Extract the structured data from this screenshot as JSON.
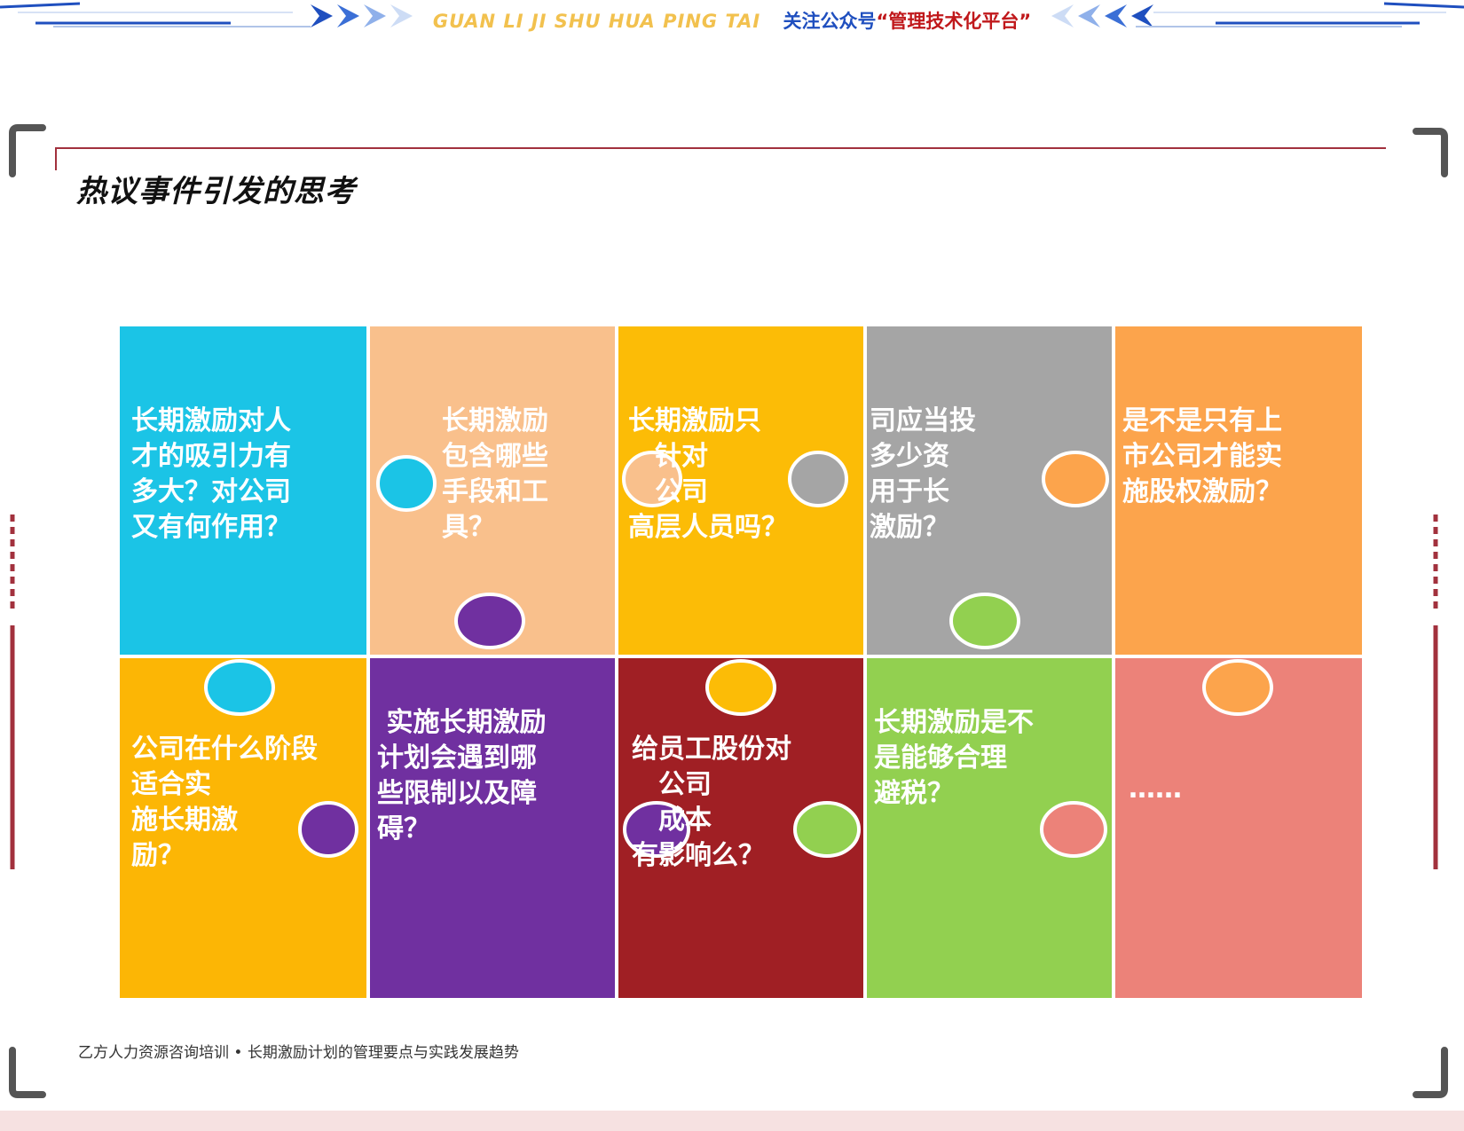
{
  "header": {
    "brand_pinyin": "GUAN LI JI SHU HUA PING TAI",
    "follow_label": "关注公众号",
    "account_name": "“管理技术化平台”"
  },
  "page_title": "热议事件引发的思考",
  "puzzle": {
    "pieces": [
      {
        "text": "长期激励对人\n才的吸引力有\n多大？对公司\n又有何作用？",
        "color": "#1bc4e6"
      },
      {
        "text": "长期激励\n包含哪些\n手段和工\n具？",
        "color": "#f9c08c"
      },
      {
        "text": "长期激励只\n　针对\n　公司\n高层人员吗？",
        "color": "#fcbc06"
      },
      {
        "text": "司应当投\n多少资\n用于长\n激励？",
        "color": "#a5a5a5"
      },
      {
        "text": "是不是只有上\n市公司才能实\n施股权激励？",
        "color": "#fca44c"
      },
      {
        "text": "公司在什么阶段\n适合实\n施长期激\n励？",
        "color": "#fcb605"
      },
      {
        "text": " 实施长期激励\n计划会遇到哪\n些限制以及障\n碍？",
        "color": "#7030a0"
      },
      {
        "text": "给员工股份对\n　公司\n　成本\n有影响么？",
        "color": "#a01f24"
      },
      {
        "text": "长期激励是不\n是能够合理\n避税？",
        "color": "#92d050"
      },
      {
        "text": "……",
        "color": "#ec8279"
      }
    ]
  },
  "footer": {
    "text": "乙方人力资源咨询培训 • 长期激励计划的管理要点与实践发展趋势"
  },
  "colors": {
    "accent_red": "#a2313d",
    "brand_blue": "#1f4fbf",
    "brand_red": "#c0181b"
  }
}
